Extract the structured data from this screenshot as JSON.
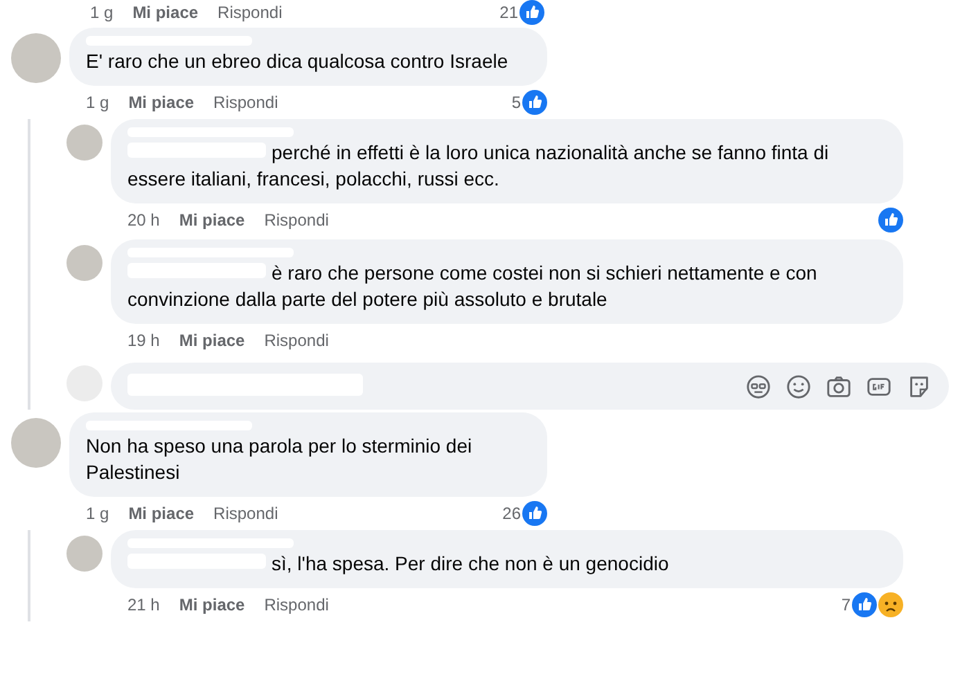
{
  "top_meta": {
    "time": "1 g",
    "like": "Mi piace",
    "reply": "Rispondi",
    "count": "21",
    "reactions": [
      {
        "kind": "like"
      }
    ]
  },
  "comments": [
    {
      "name_hidden": true,
      "mention_hidden": false,
      "text": "E' raro che un ebreo dica qualcosa contro Israele",
      "time": "1 g",
      "like": "Mi piace",
      "reply": "Rispondi",
      "count": "5",
      "reactions": [
        {
          "kind": "like"
        }
      ],
      "replies": [
        {
          "name_hidden": true,
          "mention_hidden": true,
          "text": "perché in effetti è la loro unica nazionalità anche se fanno finta di essere italiani, francesi, polacchi, russi ecc.",
          "time": "20 h",
          "like": "Mi piace",
          "reply": "Rispondi",
          "reactions": [
            {
              "kind": "like"
            }
          ]
        },
        {
          "name_hidden": true,
          "mention_hidden": true,
          "text": "è raro che persone come costei non si schieri nettamente e con convinzione dalla parte del potere più assoluto e brutale",
          "time": "19 h",
          "like": "Mi piace",
          "reply": "Rispondi"
        }
      ],
      "reply_box": {
        "value_hidden": true
      }
    },
    {
      "name_hidden": true,
      "mention_hidden": false,
      "text": "Non ha speso una parola per lo sterminio dei Palestinesi",
      "time": "1 g",
      "like": "Mi piace",
      "reply": "Rispondi",
      "count": "26",
      "reactions": [
        {
          "kind": "like"
        }
      ],
      "replies": [
        {
          "name_hidden": true,
          "mention_hidden": true,
          "text": "sì, l'ha spesa. Per dire che non è un genocidio",
          "time": "21 h",
          "like": "Mi piace",
          "reply": "Rispondi",
          "count": "7",
          "reactions": [
            {
              "kind": "like"
            },
            {
              "kind": "sad"
            }
          ]
        }
      ]
    }
  ]
}
